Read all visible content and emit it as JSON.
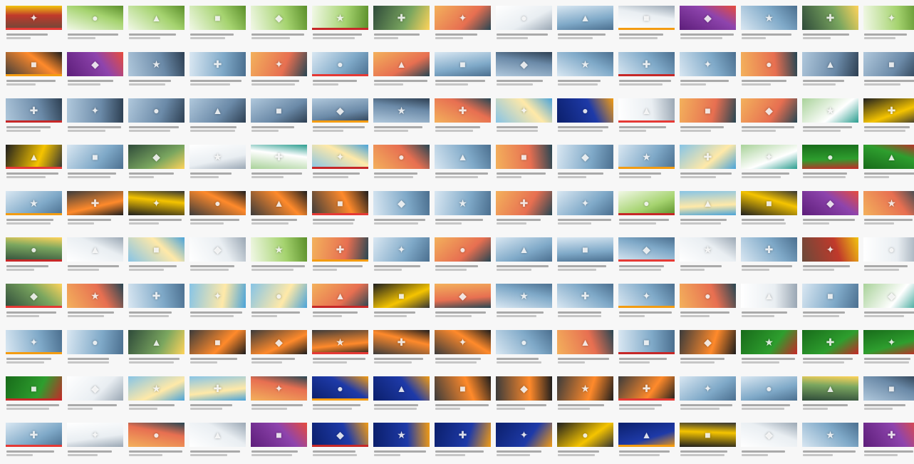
{
  "grid": {
    "columns": 15,
    "rows": 10,
    "thumbnail_style": {
      "accent_bars": [
        "#e53935",
        "#f39c12",
        "#c62828"
      ]
    },
    "palettes": [
      [
        "#6a4a3a",
        "#c0392b",
        "#f1c40f"
      ],
      [
        "#f1f8e6",
        "#a5d36f",
        "#5b8f2a"
      ],
      [
        "#3b3b3b",
        "#ff8a2b",
        "#1d1d1d"
      ],
      [
        "#2f4b3a",
        "#7aa65f",
        "#ffd35a"
      ],
      [
        "#d9e7f2",
        "#7fa9c8",
        "#4b6f8f"
      ],
      [
        "#5d1e7a",
        "#8e44ad",
        "#e74c3c"
      ],
      [
        "#87c4e6",
        "#ffe9a8",
        "#4aa3d9"
      ],
      [
        "#0b1f6b",
        "#1e3aa8",
        "#f39c12"
      ],
      [
        "#186b1a",
        "#2e9e2e",
        "#c62828"
      ],
      [
        "#ffffff",
        "#e9eef2",
        "#9aa7b4"
      ],
      [
        "#1e1e1e",
        "#f5c400",
        "#333333"
      ],
      [
        "#b0c8dc",
        "#6b8aa8",
        "#2d3f52"
      ],
      [
        "#f3b15c",
        "#e76f51",
        "#264653"
      ],
      [
        "#a9d29a",
        "#ffffff",
        "#2a9d8f"
      ]
    ],
    "cells": [
      [
        0,
        1,
        1,
        1,
        1,
        1,
        3,
        12,
        9,
        4,
        9,
        5,
        4,
        3,
        1
      ],
      [
        2,
        5,
        11,
        4,
        12,
        4,
        12,
        4,
        11,
        4,
        4,
        4,
        12,
        11,
        11
      ],
      [
        11,
        11,
        11,
        11,
        11,
        11,
        11,
        12,
        6,
        7,
        9,
        12,
        12,
        13,
        10
      ],
      [
        10,
        4,
        3,
        9,
        13,
        6,
        12,
        4,
        12,
        4,
        4,
        6,
        13,
        8,
        8
      ],
      [
        4,
        2,
        10,
        2,
        2,
        2,
        4,
        4,
        12,
        4,
        1,
        6,
        10,
        5,
        12
      ],
      [
        3,
        9,
        6,
        9,
        1,
        12,
        4,
        12,
        4,
        4,
        4,
        9,
        4,
        0,
        9
      ],
      [
        3,
        12,
        4,
        6,
        6,
        12,
        10,
        12,
        4,
        4,
        4,
        12,
        9,
        4,
        13
      ],
      [
        4,
        4,
        3,
        2,
        2,
        2,
        2,
        2,
        4,
        12,
        4,
        2,
        8,
        8,
        8
      ],
      [
        8,
        9,
        6,
        6,
        12,
        7,
        7,
        2,
        2,
        2,
        2,
        4,
        4,
        3,
        11
      ],
      [
        4,
        9,
        12,
        9,
        5,
        7,
        7,
        7,
        7,
        10,
        7,
        10,
        9,
        4,
        5
      ]
    ]
  }
}
